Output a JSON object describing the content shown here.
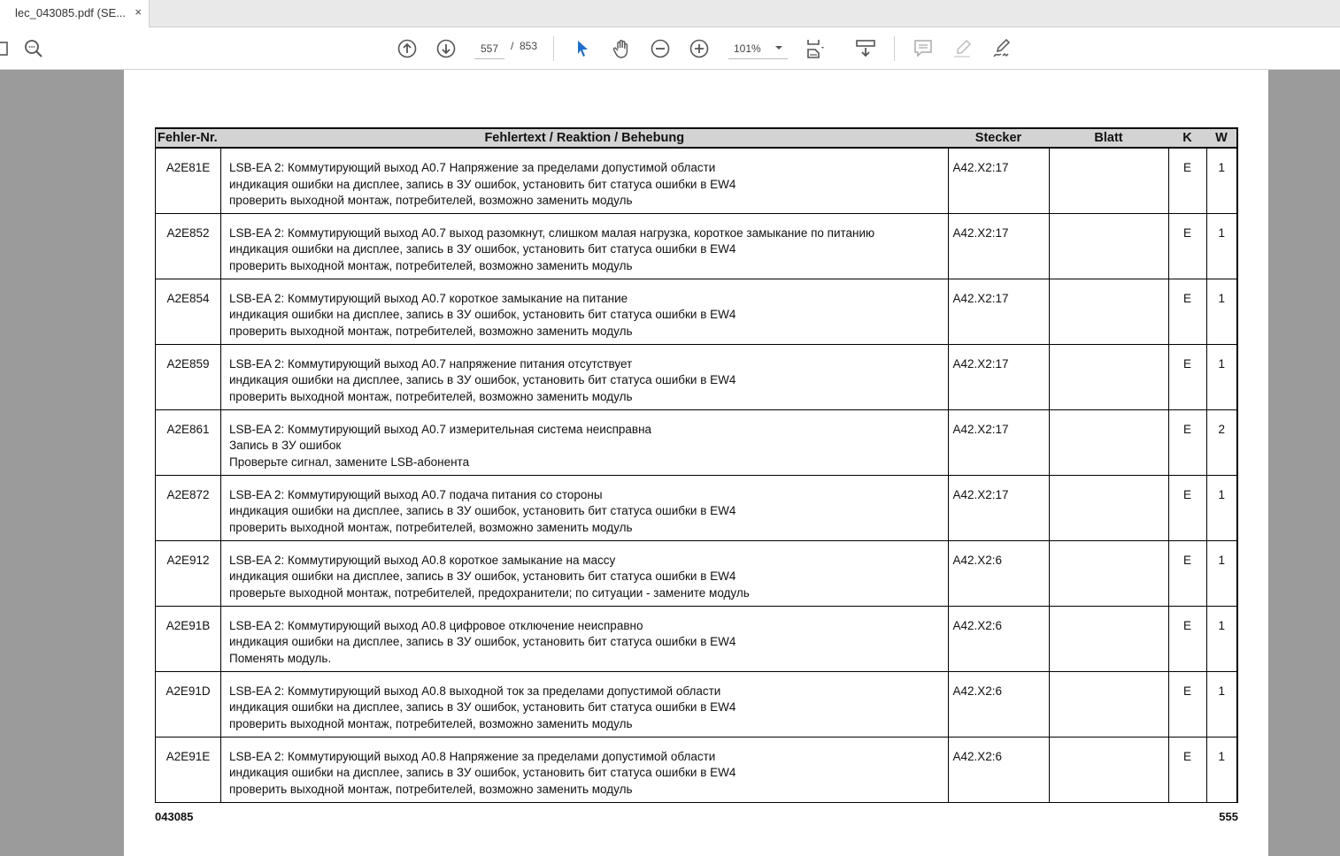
{
  "tab": {
    "title": "lec_043085.pdf (SE...",
    "close": "×"
  },
  "toolbar": {
    "page_current": "557",
    "page_sep": "/",
    "page_total": "853",
    "zoom": "101%"
  },
  "table": {
    "headers": [
      "Fehler-Nr.",
      "Fehlertext / Reaktion / Behebung",
      "Stecker",
      "Blatt",
      "K",
      "W"
    ],
    "rows": [
      {
        "nr": "A2E81E",
        "l1": "LSB-EA 2: Коммутирующий выход A0.7 Напряжение за пределами допустимой области",
        "l2": "индикация ошибки на дисплее, запись в ЗУ ошибок, установить бит статуса ошибки в EW4",
        "l3": "проверить выходной монтаж, потребителей, возможно заменить модуль",
        "stecker": "A42.X2:17",
        "blatt": "",
        "k": "E",
        "w": "1"
      },
      {
        "nr": "A2E852",
        "l1": "LSB-EA 2: Коммутирующий выход A0.7 выход разомкнут, слишком малая нагрузка, короткое замыкание по питанию",
        "l2": "индикация ошибки на дисплее, запись в ЗУ ошибок, установить бит статуса ошибки в EW4",
        "l3": "проверить выходной монтаж, потребителей, возможно заменить модуль",
        "stecker": "A42.X2:17",
        "blatt": "",
        "k": "E",
        "w": "1"
      },
      {
        "nr": "A2E854",
        "l1": "LSB-EA 2: Коммутирующий выход A0.7 короткое замыкание на питание",
        "l2": "индикация ошибки на дисплее, запись в ЗУ ошибок, установить бит статуса ошибки в EW4",
        "l3": "проверить выходной монтаж, потребителей, возможно заменить модуль",
        "stecker": "A42.X2:17",
        "blatt": "",
        "k": "E",
        "w": "1"
      },
      {
        "nr": "A2E859",
        "l1": "LSB-EA 2: Коммутирующий выход A0.7 напряжение питания отсутствует",
        "l2": "индикация ошибки на дисплее, запись в ЗУ ошибок, установить бит статуса ошибки в EW4",
        "l3": "проверить выходной монтаж, потребителей, возможно заменить модуль",
        "stecker": "A42.X2:17",
        "blatt": "",
        "k": "E",
        "w": "1"
      },
      {
        "nr": "A2E861",
        "l1": "LSB-EA 2: Коммутирующий выход A0.7 измерительная система неисправна",
        "l2": "Запись в ЗУ ошибок",
        "l3": "Проверьте сигнал, замените LSB-абонента",
        "stecker": "A42.X2:17",
        "blatt": "",
        "k": "E",
        "w": "2"
      },
      {
        "nr": "A2E872",
        "l1": "LSB-EA 2: Коммутирующий выход A0.7 подача питания со стороны",
        "l2": "индикация ошибки на дисплее, запись в ЗУ ошибок, установить бит статуса ошибки в EW4",
        "l3": "проверить выходной монтаж, потребителей, возможно заменить модуль",
        "stecker": "A42.X2:17",
        "blatt": "",
        "k": "E",
        "w": "1"
      },
      {
        "nr": "A2E912",
        "l1": "LSB-EA 2: Коммутирующий выход A0.8 короткое замыкание на массу",
        "l2": "индикация ошибки на дисплее, запись в ЗУ ошибок, установить бит статуса ошибки в EW4",
        "l3": "проверьте выходной монтаж, потребителей, предохранители; по ситуации - замените модуль",
        "stecker": "A42.X2:6",
        "blatt": "",
        "k": "E",
        "w": "1"
      },
      {
        "nr": "A2E91B",
        "l1": "LSB-EA 2: Коммутирующий выход A0.8 цифровое отключение неисправно",
        "l2": "индикация ошибки на дисплее, запись в ЗУ ошибок, установить бит статуса ошибки в EW4",
        "l3": "Поменять модуль.",
        "stecker": "A42.X2:6",
        "blatt": "",
        "k": "E",
        "w": "1"
      },
      {
        "nr": "A2E91D",
        "l1": "LSB-EA 2: Коммутирующий выход A0.8 выходной ток за пределами допустимой области",
        "l2": "индикация ошибки на дисплее, запись в ЗУ ошибок, установить бит статуса ошибки в EW4",
        "l3": "проверить выходной монтаж, потребителей, возможно заменить модуль",
        "stecker": "A42.X2:6",
        "blatt": "",
        "k": "E",
        "w": "1"
      },
      {
        "nr": "A2E91E",
        "l1": "LSB-EA 2: Коммутирующий выход A0.8 Напряжение за пределами допустимой области",
        "l2": "индикация ошибки на дисплее, запись в ЗУ ошибок, установить бит статуса ошибки в EW4",
        "l3": "проверить выходной монтаж, потребителей, возможно заменить модуль",
        "stecker": "A42.X2:6",
        "blatt": "",
        "k": "E",
        "w": "1"
      }
    ]
  },
  "footer": {
    "doc": "043085",
    "page": "555"
  }
}
